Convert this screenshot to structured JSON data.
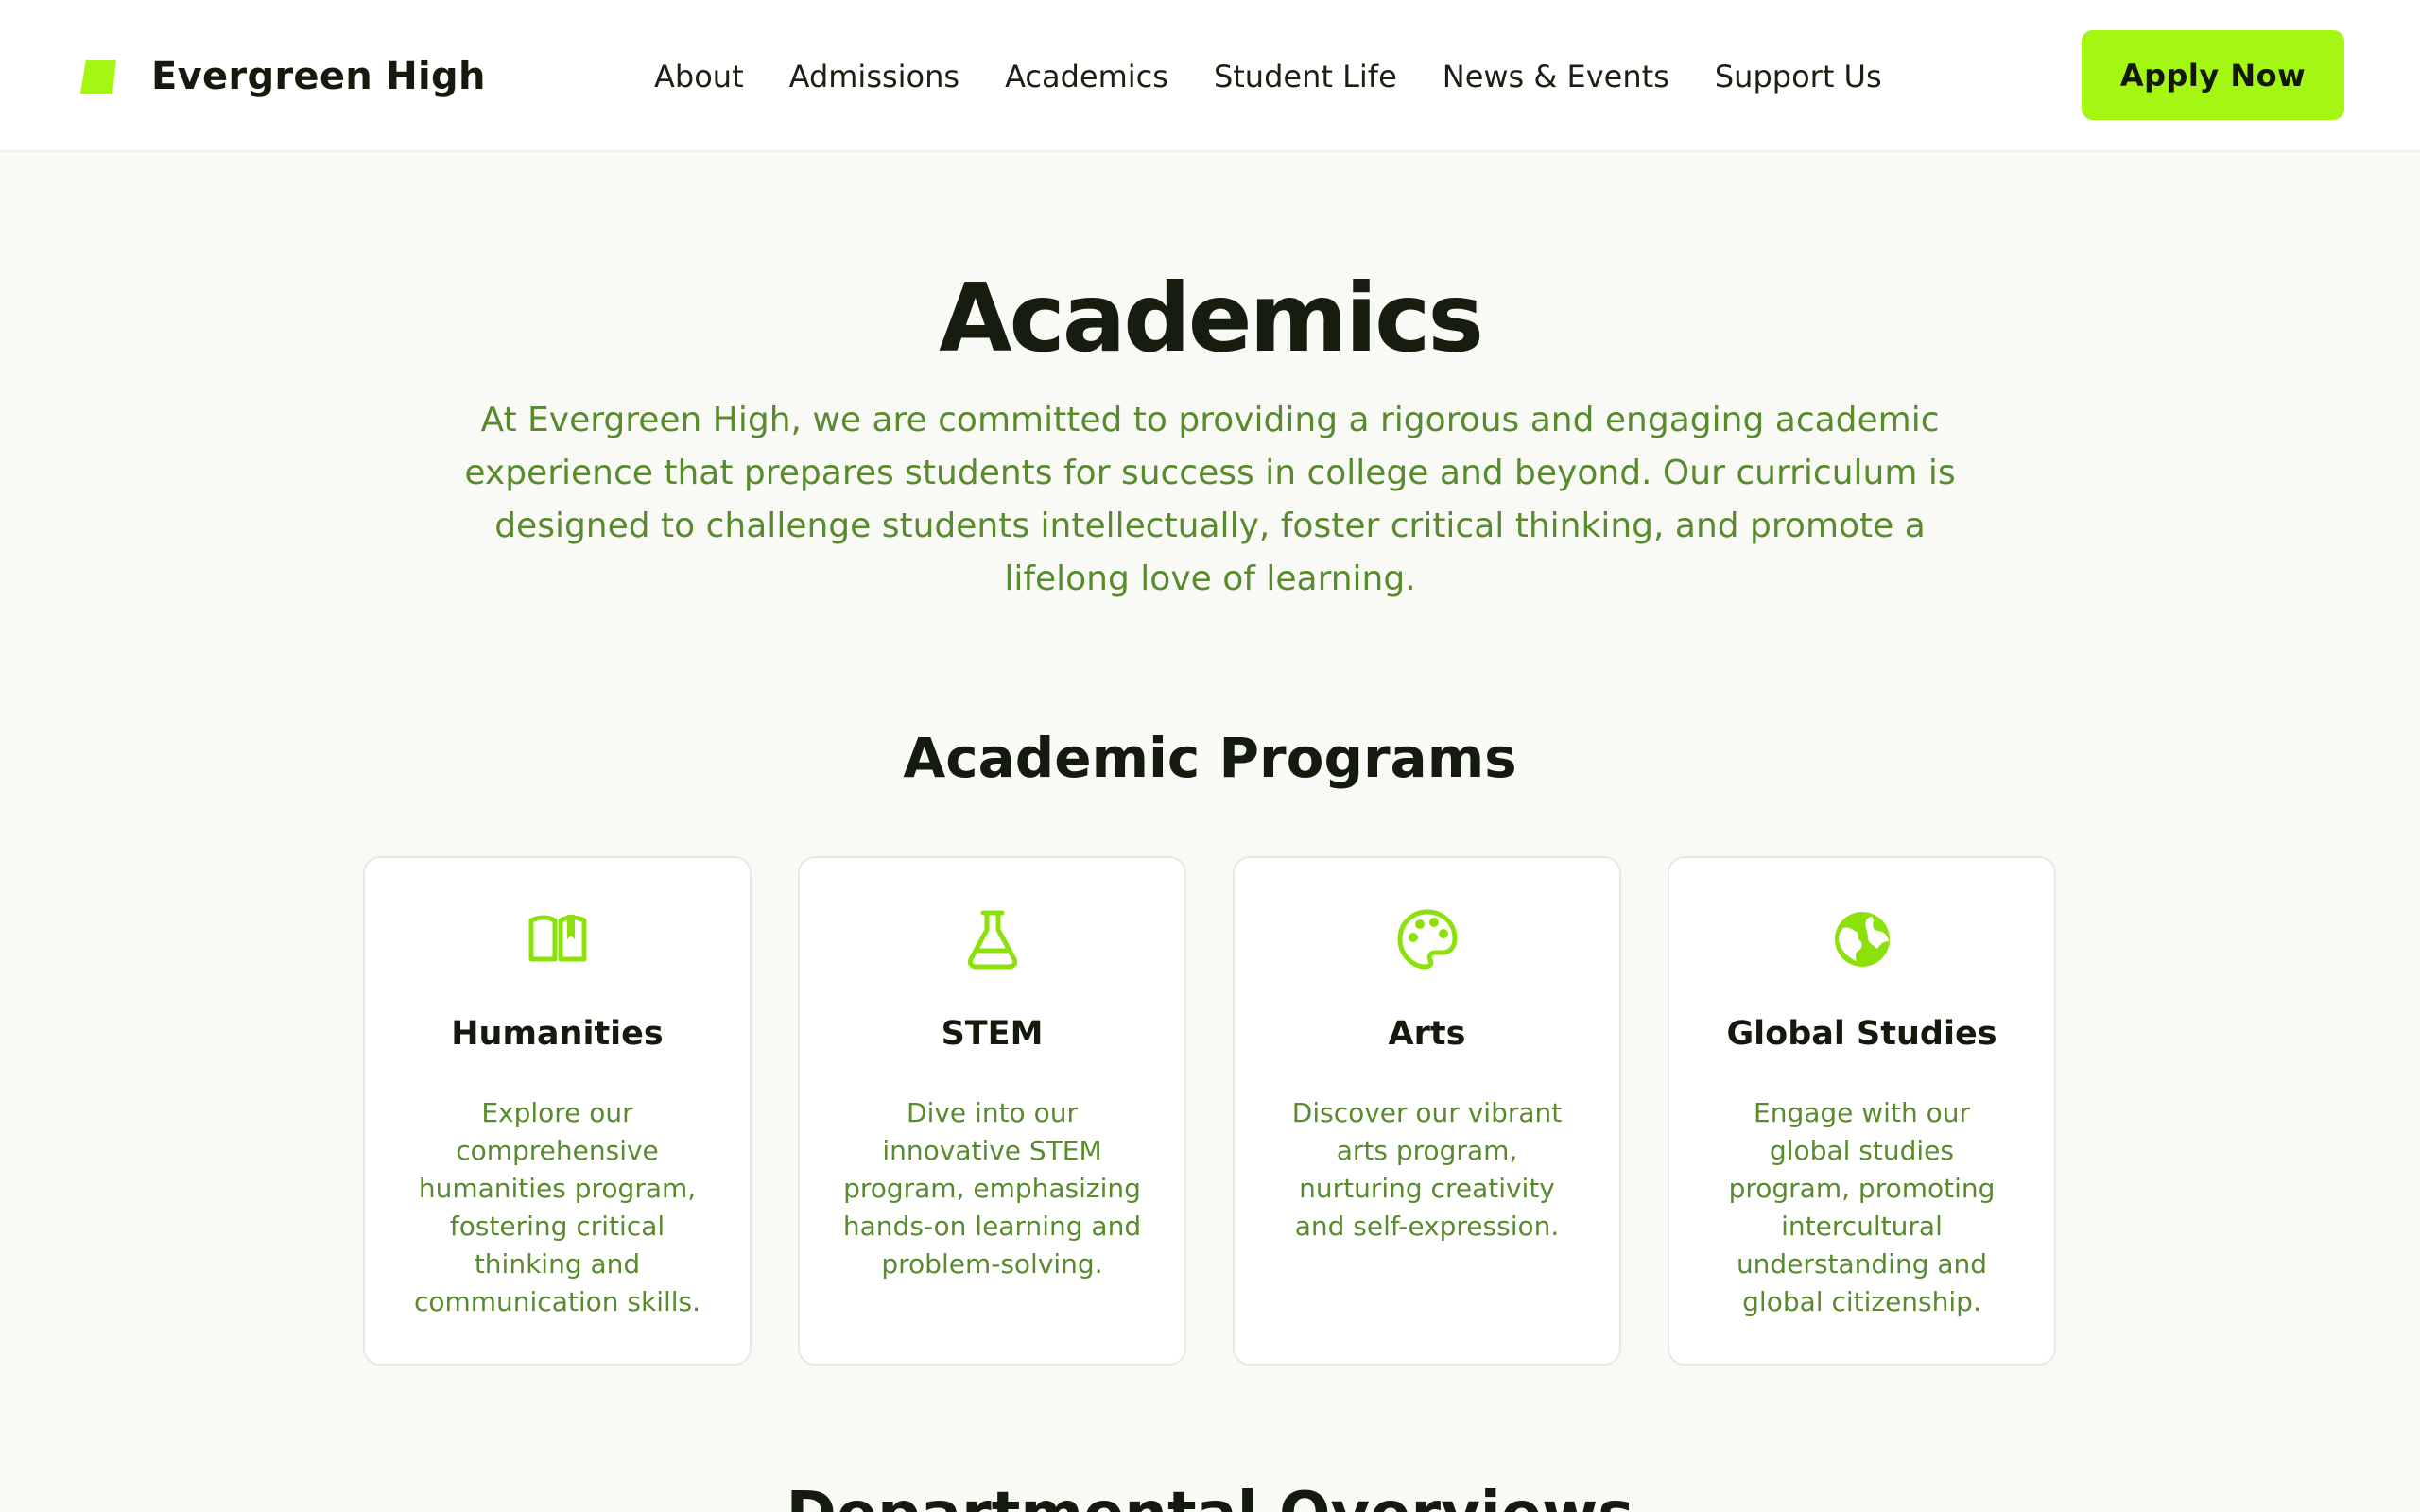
{
  "header": {
    "brand_name": "Evergreen High",
    "brand_logo_icon": "leaf-block-logo",
    "nav": [
      {
        "label": "About"
      },
      {
        "label": "Admissions"
      },
      {
        "label": "Academics"
      },
      {
        "label": "Student Life"
      },
      {
        "label": "News & Events"
      },
      {
        "label": "Support Us"
      }
    ],
    "cta_label": "Apply Now"
  },
  "intro": {
    "title": "Academics",
    "text": "At Evergreen High, we are committed to providing a rigorous and engaging academic experience that prepares students for success in college and beyond. Our curriculum is designed to challenge students intellectually, foster critical thinking, and promote a lifelong love of learning."
  },
  "programs": {
    "heading": "Academic Programs",
    "items": [
      {
        "icon": "open-book-icon",
        "title": "Humanities",
        "description": "Explore our comprehensive humanities program, fostering critical thinking and communication skills."
      },
      {
        "icon": "flask-icon",
        "title": "STEM",
        "description": "Dive into our innovative STEM program, emphasizing hands-on learning and problem-solving."
      },
      {
        "icon": "palette-icon",
        "title": "Arts",
        "description": "Discover our vibrant arts program, nurturing creativity and self-expression."
      },
      {
        "icon": "globe-icon",
        "title": "Global Studies",
        "description": "Engage with our global studies program, promoting intercultural understanding and global citizenship."
      }
    ]
  },
  "next_section": {
    "heading": "Departmental Overviews"
  },
  "colors": {
    "accent": "#a3f712",
    "text_green": "#5a8a2e",
    "heading": "#141a0d",
    "background": "#f9faf6"
  }
}
